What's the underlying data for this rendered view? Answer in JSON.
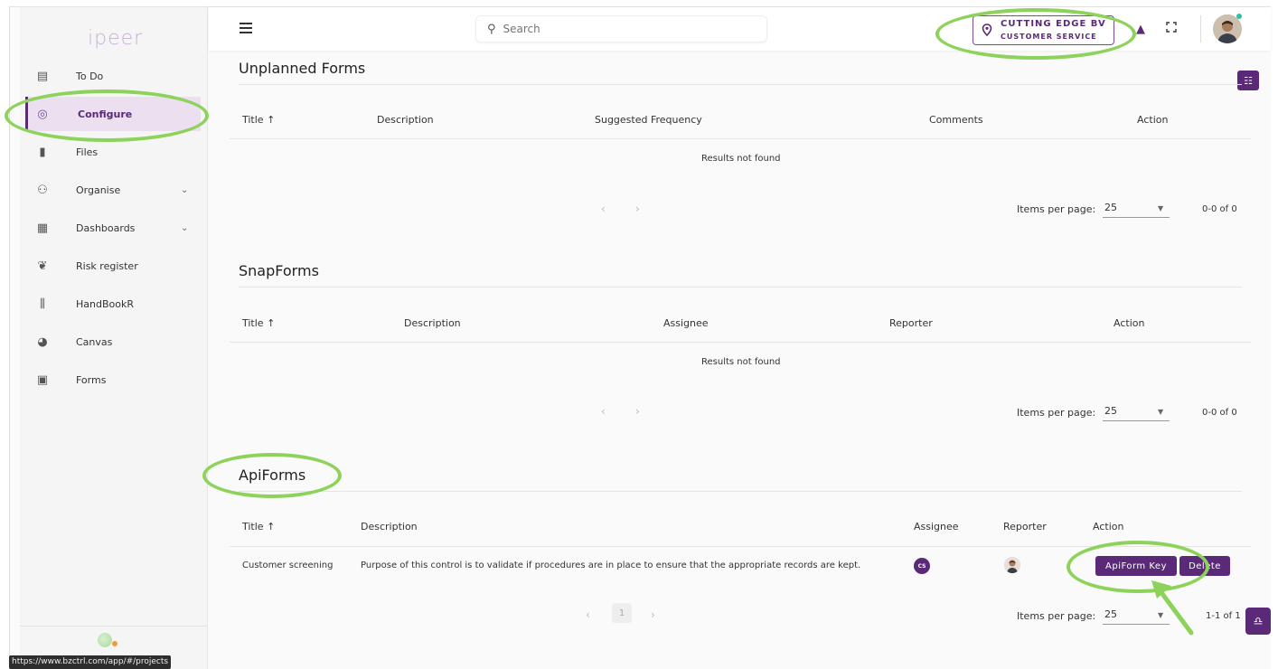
{
  "app": {
    "logo": "ipeer"
  },
  "sidebar": {
    "items": [
      {
        "label": "To Do",
        "icon": "clipboard-icon",
        "glyph": "▤"
      },
      {
        "label": "Configure",
        "icon": "configure-icon",
        "glyph": "◎",
        "active": true
      },
      {
        "label": "Files",
        "icon": "files-icon",
        "glyph": "▮"
      },
      {
        "label": "Organise",
        "icon": "people-icon",
        "glyph": "⚇",
        "has_chevron": true
      },
      {
        "label": "Dashboards",
        "icon": "dashboard-icon",
        "glyph": "▦",
        "has_chevron": true
      },
      {
        "label": "Risk register",
        "icon": "risk-icon",
        "glyph": "❦"
      },
      {
        "label": "HandBookR",
        "icon": "handbook-icon",
        "glyph": "⫼"
      },
      {
        "label": "Canvas",
        "icon": "palette-icon",
        "glyph": "◕"
      },
      {
        "label": "Forms",
        "icon": "forms-icon",
        "glyph": "▣"
      }
    ]
  },
  "topbar": {
    "search_placeholder": "Search",
    "org_name": "CUTTING EDGE BV",
    "org_unit": "CUSTOMER SERVICE"
  },
  "unplanned": {
    "title": "Unplanned Forms",
    "columns": [
      "Title",
      "Description",
      "Suggested Frequency",
      "Comments",
      "Action"
    ],
    "sort_indicator": "↑",
    "empty": "Results not found",
    "items_per_page_label": "Items per page:",
    "items_per_page": "25",
    "range": "0-0 of 0"
  },
  "snap": {
    "title": "SnapForms",
    "columns": [
      "Title",
      "Description",
      "Assignee",
      "Reporter",
      "Action"
    ],
    "sort_indicator": "↑",
    "empty": "Results not found",
    "items_per_page_label": "Items per page:",
    "items_per_page": "25",
    "range": "0-0 of 0"
  },
  "api": {
    "title": "ApiForms",
    "columns": [
      "Title",
      "Description",
      "Assignee",
      "Reporter",
      "Action"
    ],
    "sort_indicator": "↑",
    "rows": [
      {
        "title": "Customer screening",
        "description": "Purpose of this control is to validate if procedures are in place to ensure that the appropriate records are kept.",
        "assignee_initials": "CS",
        "apiform_key_label": "ApiForm Key",
        "delete_label": "Delete"
      }
    ],
    "page": "1",
    "items_per_page_label": "Items per page:",
    "items_per_page": "25",
    "range": "1-1 of 1"
  },
  "status_url": "https://www.bzctrl.com/app/#/projects",
  "colors": {
    "accent": "#5a2a78",
    "highlight": "#8dd25a",
    "active_bg": "#ebdff0"
  }
}
